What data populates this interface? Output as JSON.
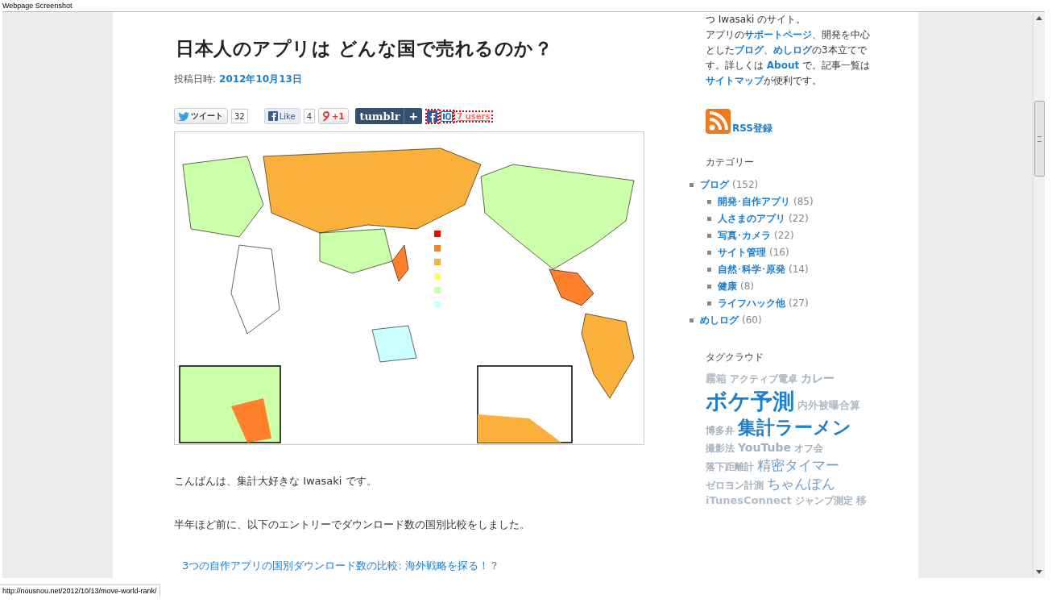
{
  "window": {
    "title": "Webpage Screenshot"
  },
  "article": {
    "title": "日本人のアプリは どんな国で売れるのか？",
    "date_label": "投稿日時:",
    "date": "2012年10月13日",
    "share": {
      "tweet_label": "ツイート",
      "tweet_count": "32",
      "like_label": "Like",
      "like_count": "4",
      "plus_one_label": "+1",
      "tumblr_label": "tumblr",
      "tumblr_plus": "+",
      "hatena_users": "7 users"
    },
    "paragraphs": [
      {
        "kind": "text",
        "text": "こんばんは、集計大好きな Iwasaki です。"
      },
      {
        "kind": "text",
        "text": "半年ほど前に、以下のエントリーでダウンロード数の国別比較をしました。"
      },
      {
        "kind": "link",
        "text": "3つの自作アプリの国別ダウンロード数の比較: 海外戦略を探る！？"
      }
    ]
  },
  "sidebar": {
    "intro": "つ Iwasaki のサイト。",
    "about": [
      {
        "kind": "text",
        "text": "アプリの"
      },
      {
        "kind": "link",
        "text": "サポートページ"
      },
      {
        "kind": "text",
        "text": "、開発を中心とした"
      },
      {
        "kind": "link",
        "text": "ブログ"
      },
      {
        "kind": "text",
        "text": "、"
      },
      {
        "kind": "link",
        "text": "めしログ"
      },
      {
        "kind": "text",
        "text": "の3本立てです。詳しくは "
      },
      {
        "kind": "link",
        "text": "About"
      },
      {
        "kind": "text",
        "text": " で。記事一覧は "
      },
      {
        "kind": "link",
        "text": "サイトマップ"
      },
      {
        "kind": "text",
        "text": "が便利です。"
      }
    ],
    "rss": "RSS登録",
    "categories_heading": "カテゴリー",
    "categories": [
      {
        "name": "ブログ",
        "count": "(152)",
        "children": [
          {
            "name": "開発･自作アプリ",
            "count": "(85)"
          },
          {
            "name": "人さまのアプリ",
            "count": "(22)"
          },
          {
            "name": "写真･カメラ",
            "count": "(22)"
          },
          {
            "name": "サイト管理",
            "count": "(16)"
          },
          {
            "name": "自然･科学･原発",
            "count": "(14)"
          },
          {
            "name": "健康",
            "count": "(8)"
          },
          {
            "name": "ライフハック他",
            "count": "(27)"
          }
        ]
      },
      {
        "name": "めしログ",
        "count": "(60)"
      }
    ],
    "tags_heading": "タグクラウド",
    "tags": [
      {
        "text": "霧箱",
        "kind": "normal"
      },
      {
        "text": "アクティブ電卓",
        "kind": "tiny"
      },
      {
        "text": "カレー",
        "kind": "medium"
      },
      {
        "text": "ボケ予測",
        "kind": "huge"
      },
      {
        "text": "内外被曝合算",
        "kind": "small"
      },
      {
        "text": "博多弁",
        "kind": "tiny"
      },
      {
        "text": "集計ラーメン",
        "kind": "large"
      },
      {
        "text": "撮影法",
        "kind": "tiny"
      },
      {
        "text": "YouTube",
        "kind": "medium"
      },
      {
        "text": "オフ会",
        "kind": "tiny"
      },
      {
        "text": "落下距離計",
        "kind": "tiny"
      },
      {
        "text": "精密タイマー",
        "kind": "big"
      },
      {
        "text": "ゼロヨン計測",
        "kind": "tiny"
      },
      {
        "text": "ちゃんぽん",
        "kind": "big"
      },
      {
        "text": "iTunesConnect",
        "kind": "normal"
      },
      {
        "text": "ジャンプ測定",
        "kind": "tiny"
      },
      {
        "text": "移",
        "kind": "normal"
      }
    ]
  },
  "status_bar": "http://nousnou.net/2012/10/13/move-world-rank/"
}
